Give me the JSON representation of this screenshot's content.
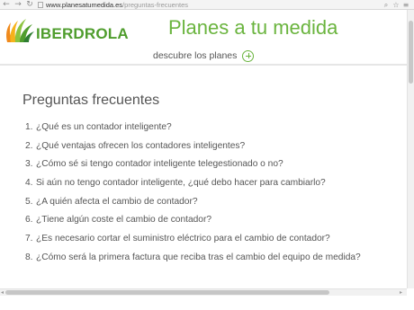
{
  "browser": {
    "url_host": "www.planesatumedida.es",
    "url_path": "/preguntas-frecuentes",
    "icons": [
      "back-icon",
      "forward-icon",
      "reload-icon",
      "page-icon",
      "zoom-icon",
      "star-icon",
      "menu-icon"
    ]
  },
  "header": {
    "logo_text": "IBERDROLA",
    "title": "Planes a tu medida",
    "subnav_label": "descubre los planes",
    "brand_color": "#6ab43e"
  },
  "faq": {
    "title": "Preguntas frecuentes",
    "items": [
      {
        "num": "1.",
        "text": "¿Qué es un contador inteligente?"
      },
      {
        "num": "2.",
        "text": "¿Qué ventajas ofrecen los contadores inteligentes?"
      },
      {
        "num": "3.",
        "text": "¿Cómo sé si tengo contador inteligente telegestionado o no?"
      },
      {
        "num": "4.",
        "text": "Si aún no tengo contador inteligente, ¿qué debo hacer para cambiarlo?"
      },
      {
        "num": "5.",
        "text": "¿A quién afecta el cambio de contador?"
      },
      {
        "num": "6.",
        "text": "¿Tiene algún coste el cambio de contador?"
      },
      {
        "num": "7.",
        "text": "¿Es necesario cortar el suministro eléctrico para el cambio de contador?"
      },
      {
        "num": "8.",
        "text": "¿Cómo será la primera factura que reciba tras el cambio del equipo de medida?"
      }
    ]
  }
}
